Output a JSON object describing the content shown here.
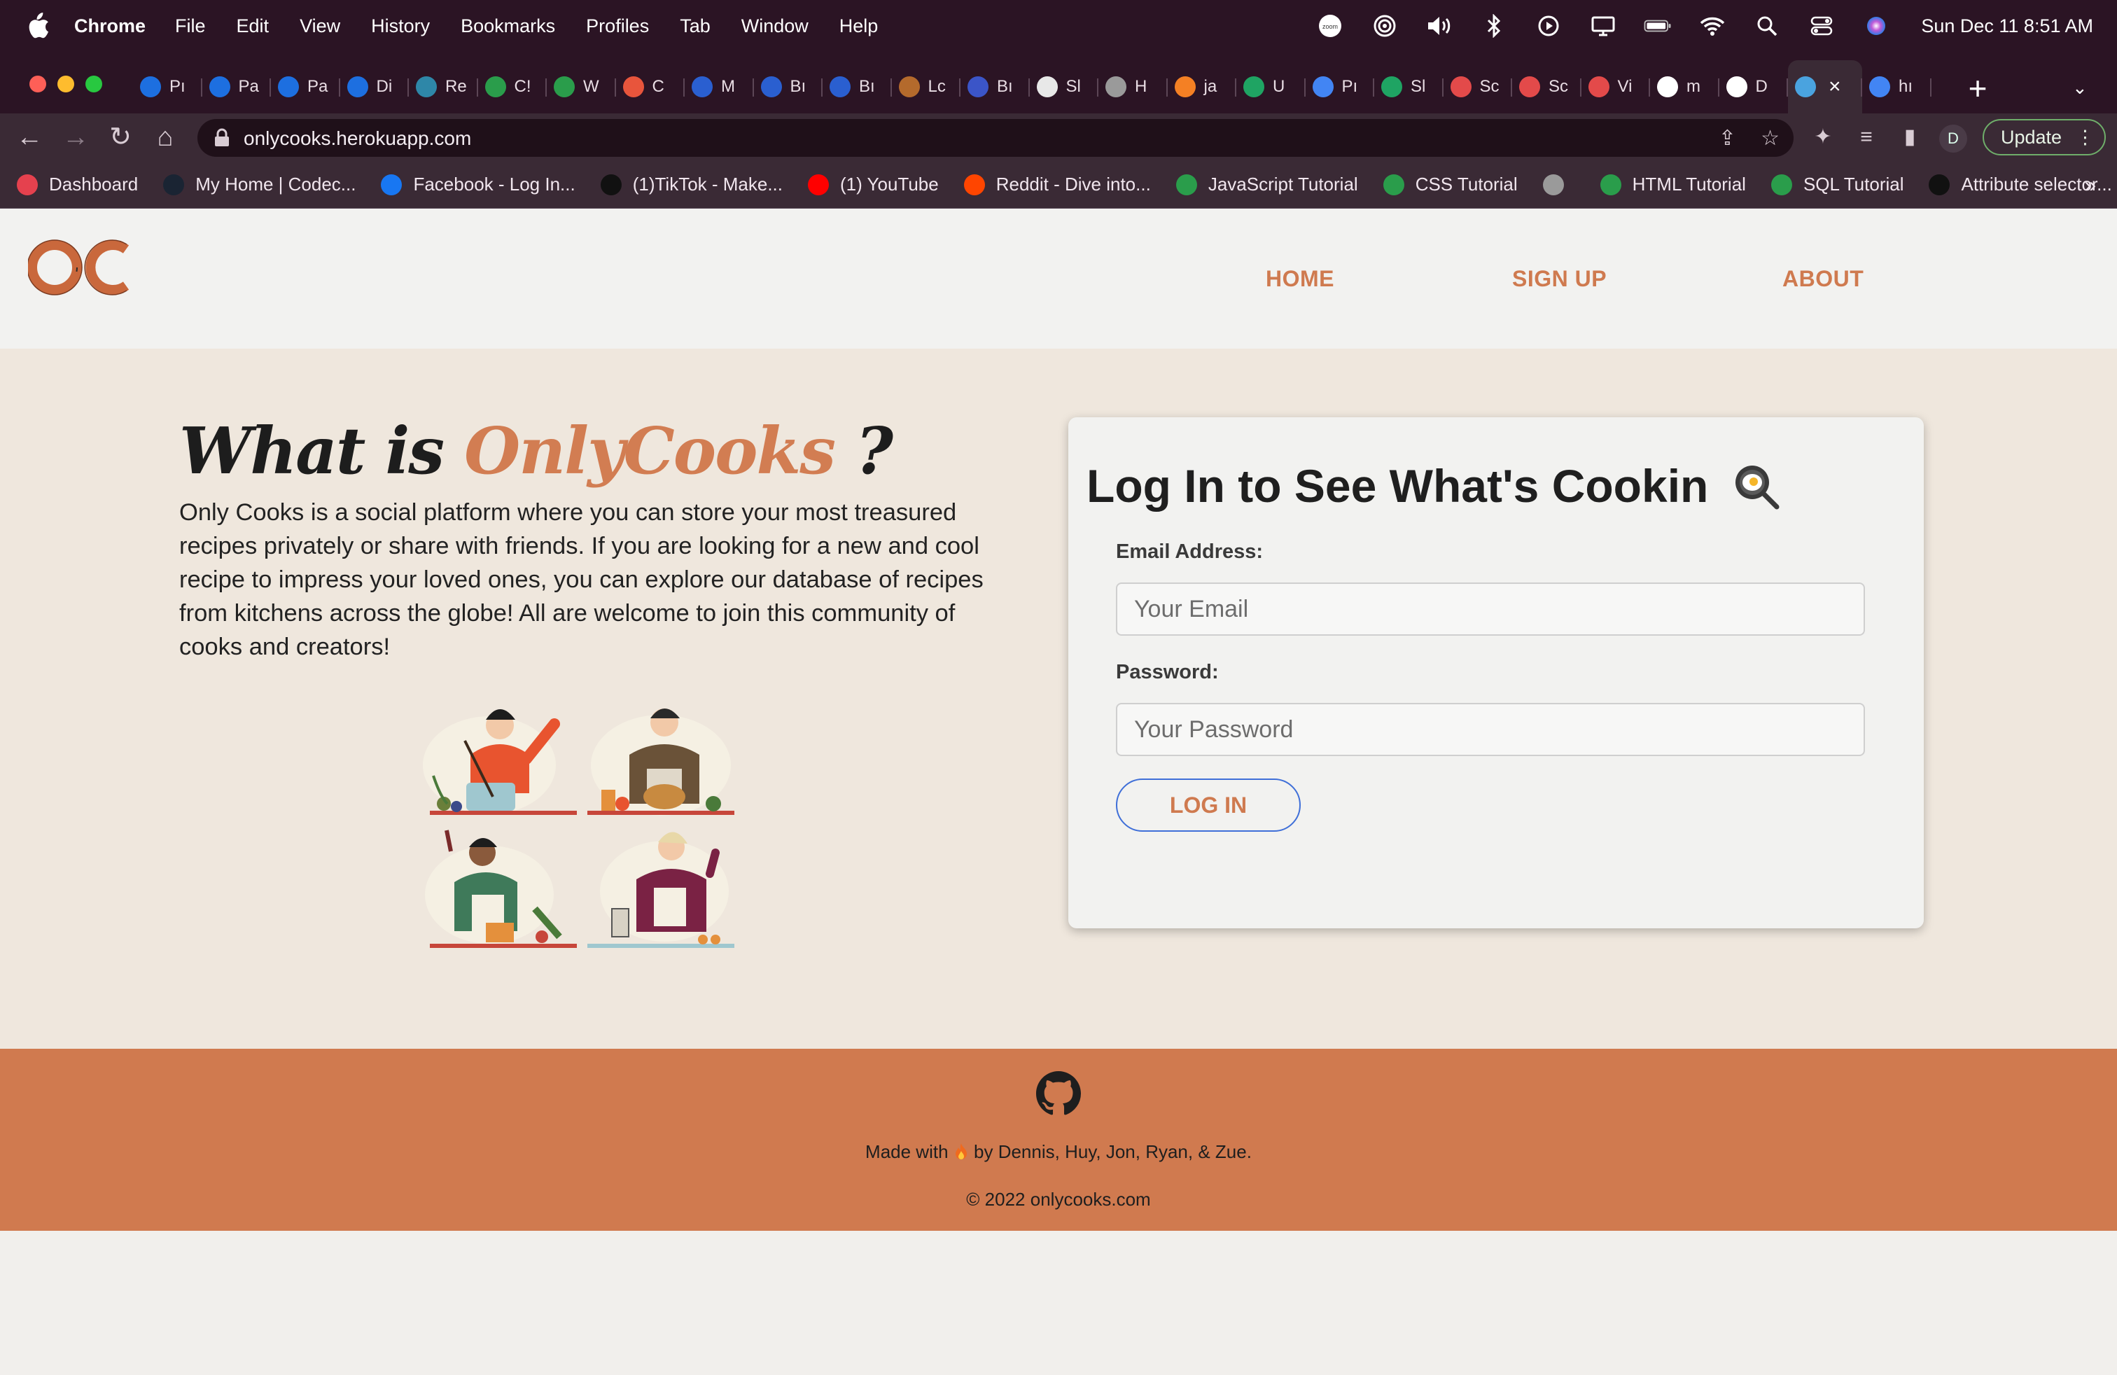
{
  "menubar": {
    "app_name": "Chrome",
    "menu_items": [
      "File",
      "Edit",
      "View",
      "History",
      "Bookmarks",
      "Profiles",
      "Tab",
      "Window",
      "Help"
    ],
    "status_icons": [
      "zoom-icon",
      "focus-icon",
      "volume-icon",
      "bluetooth-icon",
      "play-icon",
      "display-icon",
      "battery-icon",
      "wifi-icon",
      "spotlight-icon",
      "control-center-icon",
      "siri-icon"
    ],
    "clock": "Sun Dec 11  8:51 AM"
  },
  "tabs": [
    {
      "title": "Pı",
      "icon": "codecademy-icon",
      "color": "#1d6fe0"
    },
    {
      "title": "Pa",
      "icon": "codecademy-icon",
      "color": "#1d6fe0"
    },
    {
      "title": "Pa",
      "icon": "codecademy-icon",
      "color": "#1d6fe0"
    },
    {
      "title": "Di",
      "icon": "codecademy-icon",
      "color": "#1d6fe0"
    },
    {
      "title": "Re",
      "icon": "react-icon",
      "color": "#2e87a8"
    },
    {
      "title": "C!",
      "icon": "w3schools-icon",
      "color": "#2a9d4b"
    },
    {
      "title": "W",
      "icon": "w3schools-icon",
      "color": "#2a9d4b"
    },
    {
      "title": "C",
      "icon": "asterisk-icon",
      "color": "#e8553c"
    },
    {
      "title": "M",
      "icon": "bi-icon",
      "color": "#2a5fd0"
    },
    {
      "title": "Bı",
      "icon": "bi-icon",
      "color": "#2a5fd0"
    },
    {
      "title": "Bı",
      "icon": "bi-icon",
      "color": "#2a5fd0"
    },
    {
      "title": "Lc",
      "icon": "image-icon",
      "color": "#b46a2c"
    },
    {
      "title": "Bı",
      "icon": "n-icon",
      "color": "#3b55c8"
    },
    {
      "title": "Sl",
      "icon": "chatgpt-icon",
      "color": "#e8e8e8"
    },
    {
      "title": "H",
      "icon": "globe-icon",
      "color": "#9a9a9a"
    },
    {
      "title": "ja",
      "icon": "stackoverflow-icon",
      "color": "#f48024"
    },
    {
      "title": "U",
      "icon": "drive-icon",
      "color": "#1fa463"
    },
    {
      "title": "Pı",
      "icon": "google-icon",
      "color": "#4285f4"
    },
    {
      "title": "Sl",
      "icon": "drive-icon",
      "color": "#1fa463"
    },
    {
      "title": "Sc",
      "icon": "video-icon",
      "color": "#e34a4a"
    },
    {
      "title": "Sc",
      "icon": "video-icon",
      "color": "#e34a4a"
    },
    {
      "title": "Vi",
      "icon": "video-icon",
      "color": "#e34a4a"
    },
    {
      "title": "m",
      "icon": "github-icon",
      "color": "#ffffff"
    },
    {
      "title": "D",
      "icon": "github-icon",
      "color": "#ffffff"
    },
    {
      "title": "",
      "icon": "react-icon",
      "color": "#4aa3df",
      "active": true
    },
    {
      "title": "hı",
      "icon": "google-icon",
      "color": "#4285f4"
    }
  ],
  "toolbar": {
    "url": "onlycooks.herokuapp.com",
    "profile_initial": "D",
    "update_label": "Update"
  },
  "bookmarks": [
    {
      "label": "Dashboard",
      "icon": "codecademy-dashboard-icon",
      "color": "#e5414e"
    },
    {
      "label": "My Home | Codec...",
      "icon": "codecademy-icon",
      "color": "#1a2433"
    },
    {
      "label": "Facebook - Log In...",
      "icon": "facebook-icon",
      "color": "#1877f2"
    },
    {
      "label": "(1)TikTok - Make...",
      "icon": "tiktok-icon",
      "color": "#111111"
    },
    {
      "label": "(1) YouTube",
      "icon": "youtube-icon",
      "color": "#ff0000"
    },
    {
      "label": "Reddit - Dive into...",
      "icon": "reddit-icon",
      "color": "#ff4500"
    },
    {
      "label": "JavaScript Tutorial",
      "icon": "w3schools-icon",
      "color": "#2a9d4b"
    },
    {
      "label": "CSS Tutorial",
      "icon": "w3schools-icon",
      "color": "#2a9d4b"
    },
    {
      "label": "",
      "icon": "globe-icon",
      "color": "#9a9a9a"
    },
    {
      "label": "HTML Tutorial",
      "icon": "w3schools-icon",
      "color": "#2a9d4b"
    },
    {
      "label": "SQL Tutorial",
      "icon": "w3schools-icon",
      "color": "#2a9d4b"
    },
    {
      "label": "Attribute selector...",
      "icon": "mdn-icon",
      "color": "#111111"
    }
  ],
  "site": {
    "logo_text": "OC",
    "nav": {
      "home": "HOME",
      "signup": "SIGN UP",
      "about": "ABOUT"
    },
    "accent": "#d27d52",
    "hero": {
      "title_prefix": "What is",
      "title_brand": "OnlyCooks",
      "title_suffix": "?",
      "paragraph": "Only Cooks is a social platform where you can store your most treasured recipes privately or share with friends. If you are looking for a new and cool recipe to impress your loved ones, you can explore our database of recipes from kitchens across the globe! All are welcome to join this community of cooks and creators!"
    },
    "login": {
      "title": "Log In to See What's Cookin",
      "email_label": "Email Address:",
      "email_placeholder": "Your Email",
      "password_label": "Password:",
      "password_placeholder": "Your Password",
      "button": "LOG IN"
    },
    "footer": {
      "credit_prefix": "Made with",
      "credit_suffix": "by Dennis, Huy, Jon, Ryan, & Zue.",
      "copyright": "© 2022 onlycooks.com"
    }
  }
}
